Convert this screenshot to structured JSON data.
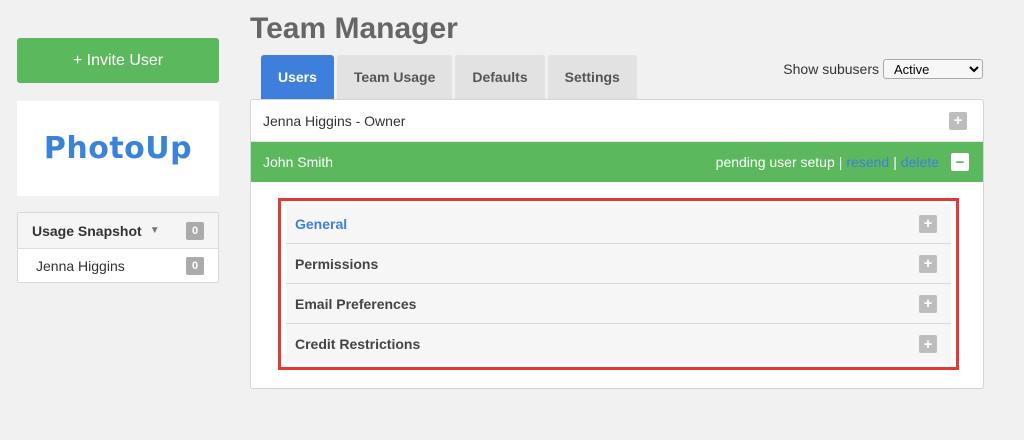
{
  "sidebar": {
    "invite_label": "+ Invite User",
    "logo_text": "PhotoUp",
    "usage": {
      "title": "Usage Snapshot",
      "title_count": "0",
      "rows": [
        {
          "name": "Jenna Higgins",
          "count": "0"
        }
      ]
    }
  },
  "header": {
    "title": "Team Manager"
  },
  "tabs": [
    {
      "label": "Users"
    },
    {
      "label": "Team Usage"
    },
    {
      "label": "Defaults"
    },
    {
      "label": "Settings"
    }
  ],
  "subusers": {
    "label": "Show subusers",
    "selected": "Active"
  },
  "users": {
    "owner": "Jenna Higgins - Owner",
    "active_user": "John Smith",
    "status": "pending user setup",
    "sep1": "|",
    "resend": "resend",
    "sep2": "|",
    "delete": "delete"
  },
  "sections": [
    {
      "label": "General"
    },
    {
      "label": "Permissions"
    },
    {
      "label": "Email Preferences"
    },
    {
      "label": "Credit Restrictions"
    }
  ],
  "icons": {
    "plus": "+",
    "minus": "−",
    "caret": "▼"
  },
  "colors": {
    "accent": "#3f7fdc",
    "success": "#5cb85c",
    "highlight": "#e53935"
  }
}
